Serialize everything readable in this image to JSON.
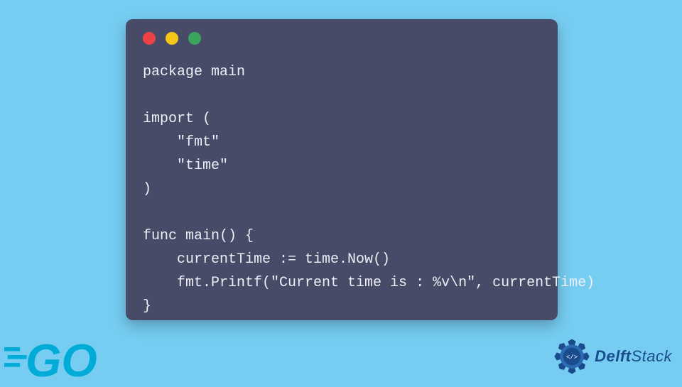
{
  "code": {
    "line1": "package main",
    "line2": "",
    "line3": "import (",
    "line4": "    \"fmt\"",
    "line5": "    \"time\"",
    "line6": ")",
    "line7": "",
    "line8": "func main() {",
    "line9": "    currentTime := time.Now()",
    "line10": "    fmt.Printf(\"Current time is : %v\\n\", currentTime)",
    "line11": "}"
  },
  "logos": {
    "go": "GO",
    "delft_prefix": "Delft",
    "delft_suffix": "Stack"
  },
  "colors": {
    "background": "#76cdf1",
    "window": "#474b68",
    "text": "#eceff4",
    "go_blue": "#00acd7",
    "delft_blue": "#1a4b8c"
  }
}
